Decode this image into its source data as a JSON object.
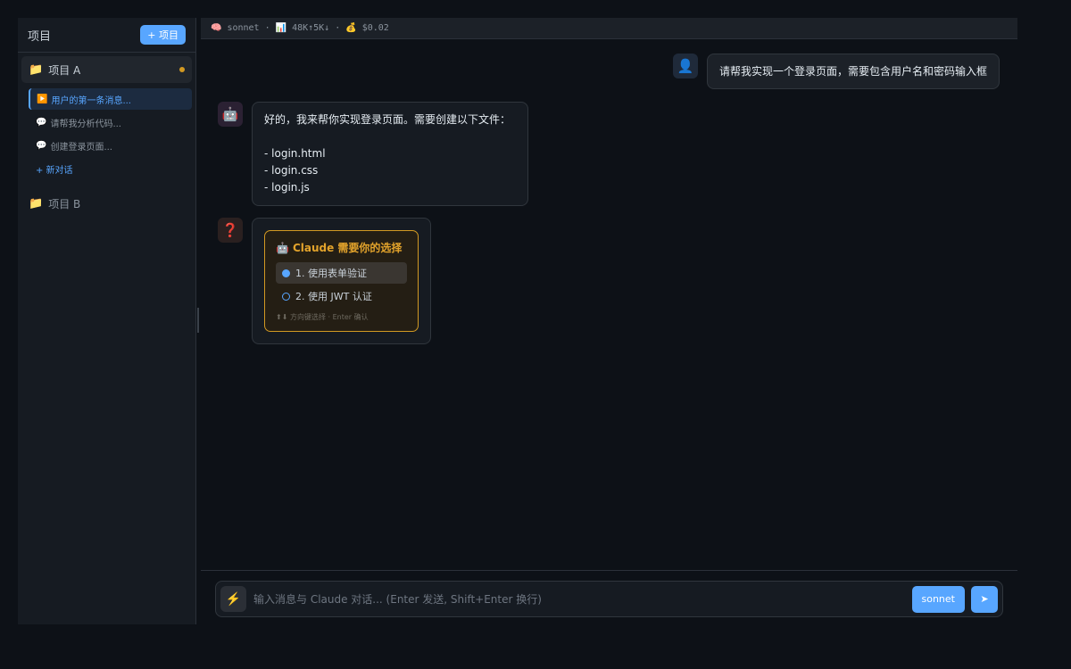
{
  "sidebar": {
    "title": "项目",
    "add_project_label": "+ 项目",
    "projects": [
      {
        "name": "项目 A",
        "icon": "folder-icon",
        "conversations": [
          {
            "icon": "play-icon",
            "label": "用户的第一条消息..."
          },
          {
            "icon": "speech-bubble-icon",
            "label": "请帮我分析代码..."
          },
          {
            "icon": "speech-bubble-icon",
            "label": "创建登录页面..."
          }
        ],
        "new_conversation_label": "+ 新对话"
      },
      {
        "name": "项目 B",
        "icon": "folder-icon"
      }
    ]
  },
  "statusbar": {
    "model_icon": "🧠",
    "model": "sonnet",
    "sep": "·",
    "tokens_icon": "📊",
    "tokens": "48K↑5K↓",
    "cost_icon": "💰",
    "cost": "$0.02"
  },
  "chat": {
    "user_message": "请帮我实现一个登录页面，需要包含用户名和密码输入框",
    "assistant_lines": [
      "好的，我来帮你实现登录页面。需要创建以下文件：",
      "",
      "- login.html",
      "- login.css",
      "- login.js"
    ],
    "choice": {
      "title": "Claude 需要你的选择",
      "options": [
        "1. 使用表单验证",
        "2. 使用 JWT 认证"
      ],
      "hint": "⬆⬇ 方向键选择 · Enter 确认"
    }
  },
  "input": {
    "placeholder": "输入消息与 Claude 对话... (Enter 发送, Shift+Enter 换行)",
    "model_label": "sonnet",
    "send_label": "➤"
  },
  "colors": {
    "accent": "#58a6ff",
    "warning": "#d29922"
  }
}
